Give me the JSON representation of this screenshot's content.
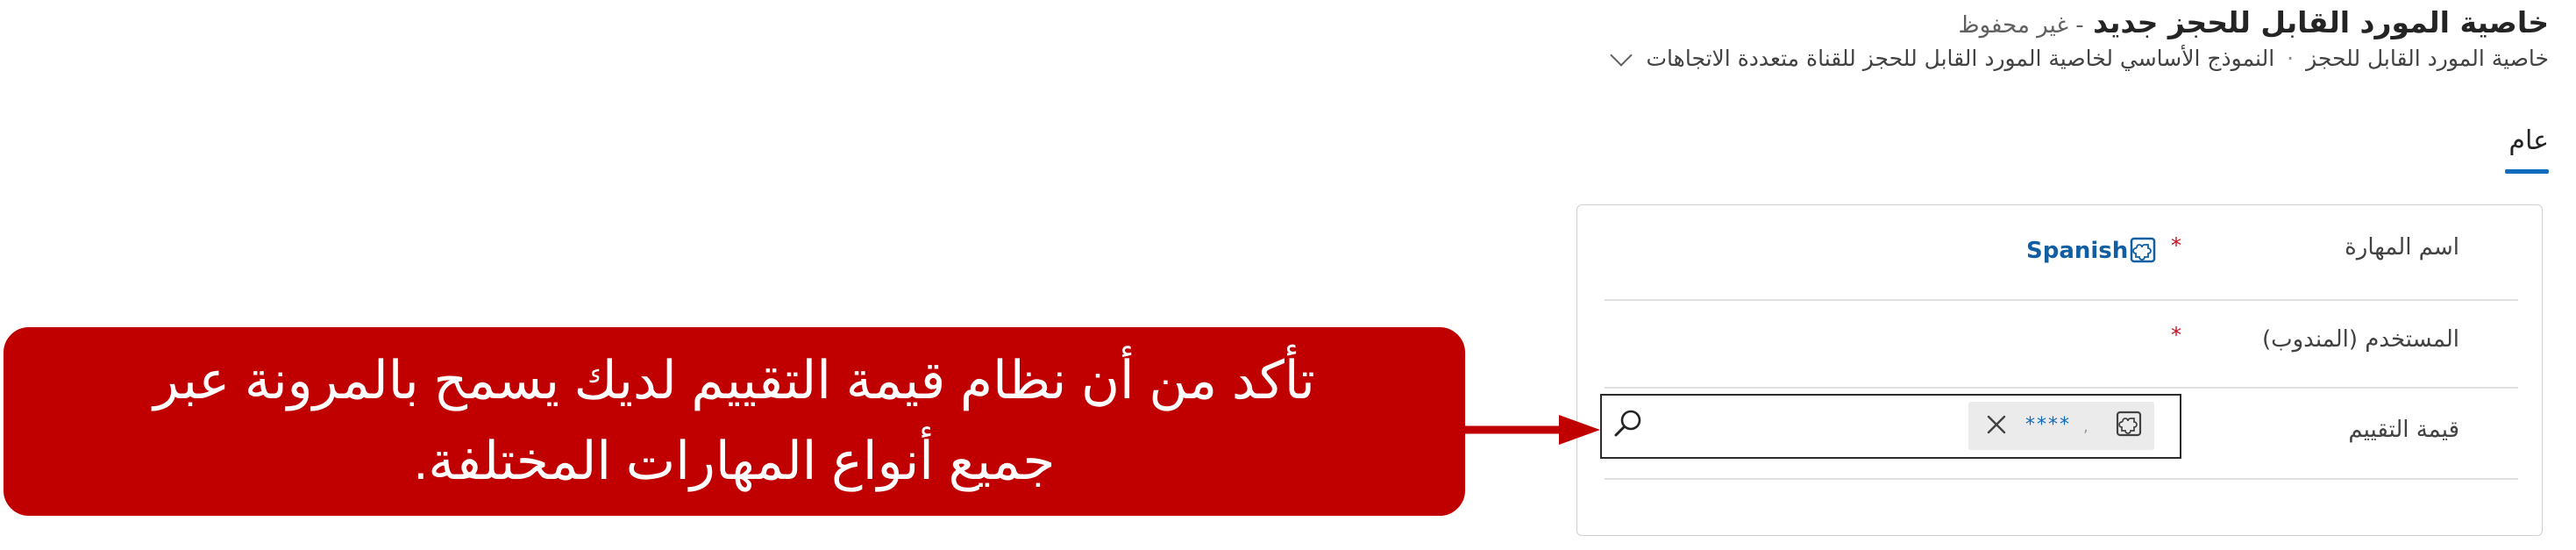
{
  "header": {
    "title": "خاصية المورد القابل للحجز جديد",
    "status": "- غير محفوظ",
    "breadcrumb": {
      "item1": "خاصية المورد القابل للحجز",
      "separator": "·",
      "item2": "النموذج الأساسي لخاصية المورد القابل للحجز للقناة متعددة الاتجاهات"
    }
  },
  "tabs": [
    {
      "label": "عام",
      "selected": true
    }
  ],
  "form": {
    "fields": [
      {
        "label": "اسم المهارة",
        "required_marker": "*",
        "value": "Spanish",
        "icon": "entity-record-icon"
      },
      {
        "label": "المستخدم (المندوب)",
        "required_marker": "*",
        "value": ""
      },
      {
        "label": "قيمة التقييم",
        "value": "****",
        "chip_separator": ",",
        "icon": "entity-record-icon",
        "clear_icon": "close-icon",
        "search_icon": "search-icon"
      }
    ]
  },
  "callout": {
    "line1": "تأكد من أن نظام قيمة التقييم لديك يسمح بالمرونة عبر",
    "line2": "جميع أنواع المهارات المختلفة.",
    "color": "#c00000"
  },
  "accent_color": "#0f6cbd"
}
